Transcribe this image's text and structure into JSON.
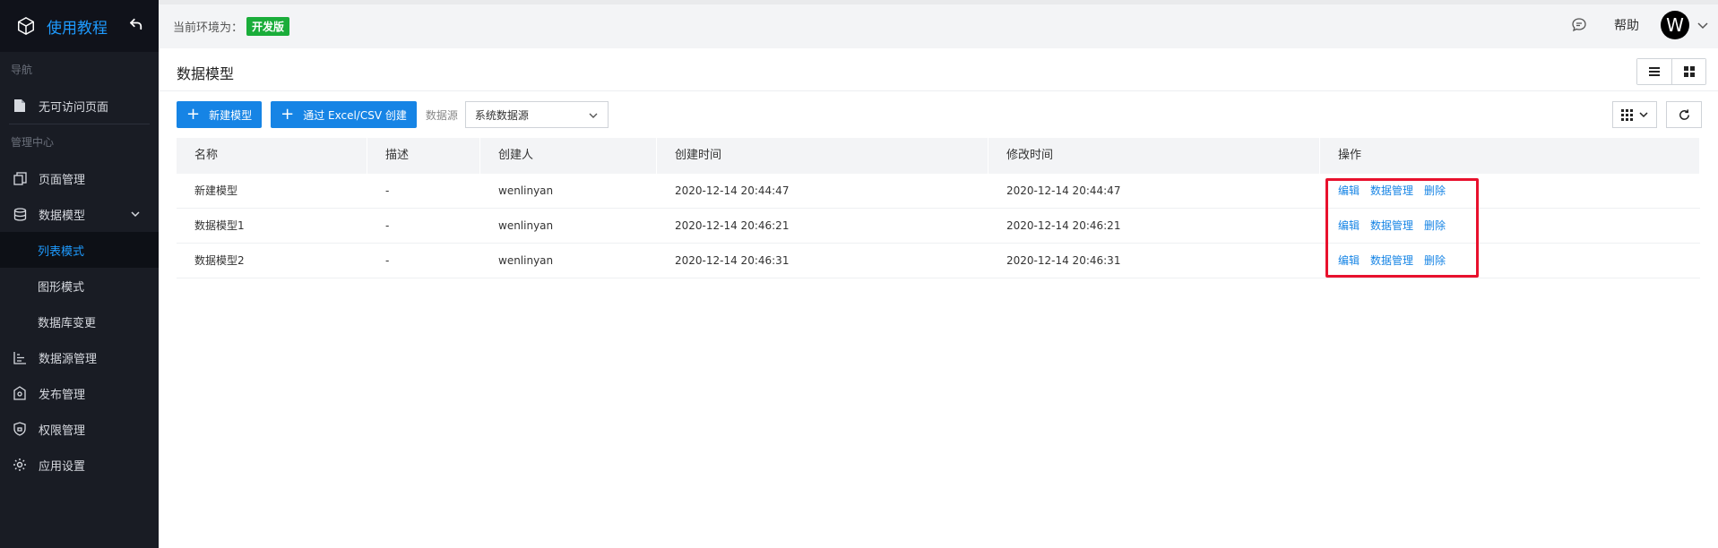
{
  "sidebar": {
    "app_title": "使用教程",
    "groups": {
      "nav": "导航",
      "admin": "管理中心"
    },
    "items": [
      {
        "label": "无可访问页面",
        "icon": "file-icon"
      },
      {
        "label": "页面管理",
        "icon": "pages-icon"
      },
      {
        "label": "数据模型",
        "icon": "database-icon",
        "expanded": true
      },
      {
        "label": "列表模式",
        "sub": true,
        "active": true
      },
      {
        "label": "图形模式",
        "sub": true
      },
      {
        "label": "数据库变更",
        "sub": true
      },
      {
        "label": "数据源管理",
        "icon": "datasource-icon"
      },
      {
        "label": "发布管理",
        "icon": "publish-icon"
      },
      {
        "label": "权限管理",
        "icon": "permission-icon"
      },
      {
        "label": "应用设置",
        "icon": "gear-icon"
      }
    ]
  },
  "topbar": {
    "env_label": "当前环境为：",
    "env_badge": "开发版",
    "help": "帮助",
    "avatar_letter": "W"
  },
  "page": {
    "title": "数据模型"
  },
  "toolbar": {
    "new_model": "新建模型",
    "import": "通过 Excel/CSV 创建",
    "datasource_label": "数据源",
    "datasource_value": "系统数据源"
  },
  "table": {
    "headers": [
      "名称",
      "描述",
      "创建人",
      "创建时间",
      "修改时间",
      "操作"
    ],
    "rows": [
      {
        "name": "新建模型",
        "desc": "-",
        "creator": "wenlinyan",
        "created": "2020-12-14 20:44:47",
        "modified": "2020-12-14 20:44:47"
      },
      {
        "name": "数据模型1",
        "desc": "-",
        "creator": "wenlinyan",
        "created": "2020-12-14 20:46:21",
        "modified": "2020-12-14 20:46:21"
      },
      {
        "name": "数据模型2",
        "desc": "-",
        "creator": "wenlinyan",
        "created": "2020-12-14 20:46:31",
        "modified": "2020-12-14 20:46:31"
      }
    ],
    "actions": {
      "edit": "编辑",
      "manage": "数据管理",
      "delete": "删除"
    }
  },
  "colors": {
    "accent": "#1684e5",
    "sidebar_bg": "#191c24",
    "badge_green": "#1aad3a",
    "highlight": "#e8112d"
  }
}
